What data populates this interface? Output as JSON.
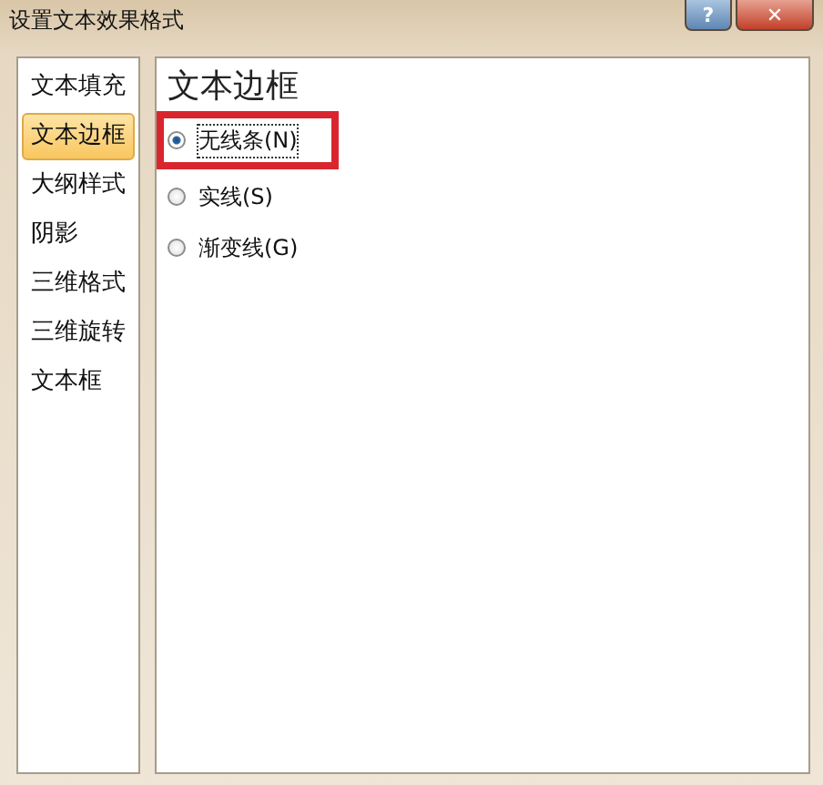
{
  "window": {
    "title": "设置文本效果格式",
    "help_button": "?",
    "close_button": "✕"
  },
  "sidebar": {
    "items": [
      {
        "label": "文本填充",
        "selected": false
      },
      {
        "label": "文本边框",
        "selected": true
      },
      {
        "label": "大纲样式",
        "selected": false
      },
      {
        "label": "阴影",
        "selected": false
      },
      {
        "label": "三维格式",
        "selected": false
      },
      {
        "label": "三维旋转",
        "selected": false
      },
      {
        "label": "文本框",
        "selected": false
      }
    ]
  },
  "panel": {
    "heading": "文本边框",
    "options": [
      {
        "label": "无线条(N)",
        "selected": true,
        "highlighted": true
      },
      {
        "label": "实线(S)",
        "selected": false,
        "highlighted": false
      },
      {
        "label": "渐变线(G)",
        "selected": false,
        "highlighted": false
      }
    ]
  }
}
